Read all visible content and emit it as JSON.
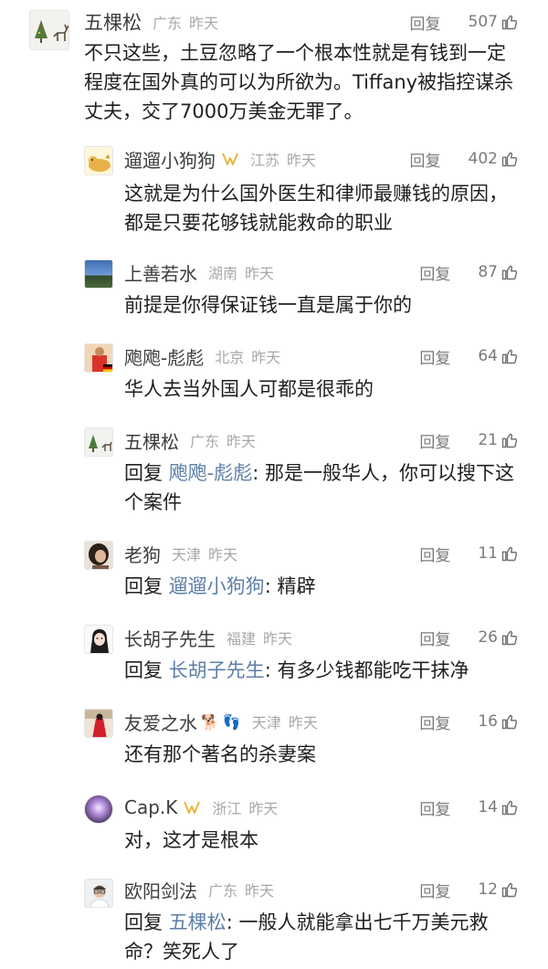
{
  "reply_label": "回复",
  "time_label": "昨天",
  "comments": [
    {
      "user": "五棵松",
      "region": "广东",
      "likes": "507",
      "text": "不只这些，土豆忽略了一个根本性就是有钱到一定程度在国外真的可以为所欲为。Tiffany被指控谋杀丈夫，交了7000万美金无罪了。",
      "avatar": "tree-reindeer"
    },
    {
      "user": "遛遛小狗狗",
      "region": "江苏",
      "likes": "402",
      "badge": "vip-badge",
      "text": "这就是为什么国外医生和律师最赚钱的原因，都是只要花够钱就能救命的职业",
      "avatar": "cartoon-dog"
    },
    {
      "user": "上善若水",
      "region": "湖南",
      "likes": "87",
      "text": "前提是你得保证钱一直是属于你的",
      "avatar": "landscape"
    },
    {
      "user": "飑飑-彪彪",
      "region": "北京",
      "likes": "64",
      "text": "华人去当外国人可都是很乖的",
      "avatar": "athlete"
    },
    {
      "user": "五棵松",
      "region": "广东",
      "likes": "21",
      "reply_to": "飑飑-彪彪",
      "text": "那是一般华人，你可以搜下这个案件",
      "avatar": "tree-reindeer"
    },
    {
      "user": "老狗",
      "region": "天津",
      "likes": "11",
      "reply_to": "遛遛小狗狗",
      "text": "精辟",
      "avatar": "woman-portrait"
    },
    {
      "user": "长胡子先生",
      "region": "福建",
      "likes": "26",
      "reply_to": "长胡子先生",
      "text": "有多少钱都能吃干抹净",
      "avatar": "girl-sketch"
    },
    {
      "user": "友爱之水",
      "region": "天津",
      "likes": "16",
      "emojis": [
        "🐕",
        "👣"
      ],
      "text": "还有那个著名的杀妻案",
      "avatar": "woman-red-dress"
    },
    {
      "user": "Cap.K",
      "region": "浙江",
      "likes": "14",
      "badge": "vip-badge",
      "text": "对，这才是根本",
      "avatar": "purple-orb"
    },
    {
      "user": "欧阳剑法",
      "region": "广东",
      "likes": "12",
      "reply_to": "五棵松",
      "text": "一般人就能拿出七千万美元救命？笑死人了",
      "avatar": "man-glasses"
    }
  ],
  "colors": {
    "username": "#3d3d3d",
    "meta": "#a8a8a8",
    "action": "#7a7a7a",
    "reply_ref": "#5c7fa8",
    "vip_badge": "#e9b640"
  }
}
